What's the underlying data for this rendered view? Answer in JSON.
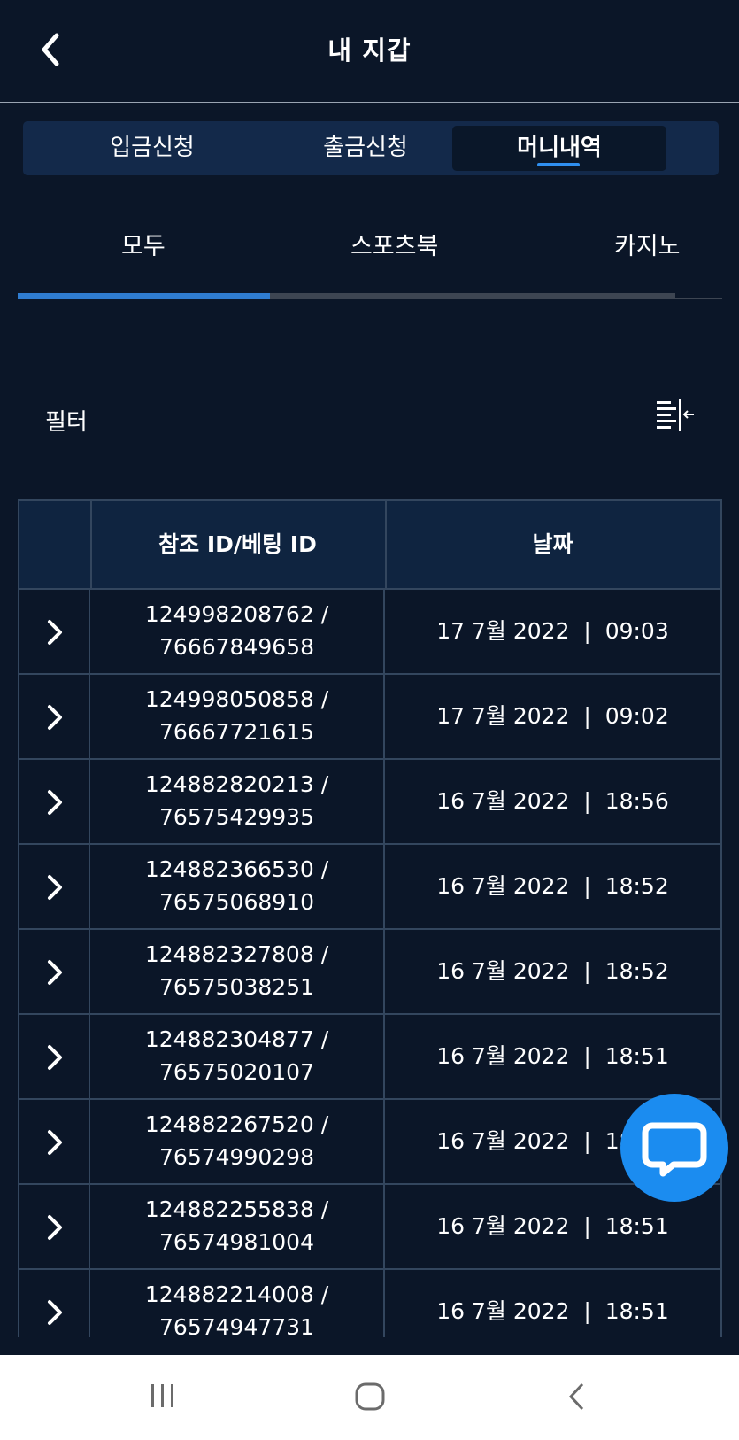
{
  "header": {
    "title": "내 지갑",
    "back_icon": "chevron-left-icon"
  },
  "wallet_tabs": [
    {
      "label": "입금신청",
      "active": false
    },
    {
      "label": "출금신청",
      "active": false
    },
    {
      "label": "머니내역",
      "active": true
    }
  ],
  "category_tabs": [
    {
      "label": "모두",
      "active": true
    },
    {
      "label": "스포츠북",
      "active": false
    },
    {
      "label": "카지노",
      "active": false
    }
  ],
  "filter": {
    "label": "필터",
    "icon": "filter-collapse-icon"
  },
  "table": {
    "headers": [
      "",
      "참조 ID/베팅 ID",
      "날짜"
    ],
    "rows": [
      {
        "ref": "124998208762 /",
        "bet": "76667849658",
        "date": "17 7월 2022  |  09:03"
      },
      {
        "ref": "124998050858 /",
        "bet": "76667721615",
        "date": "17 7월 2022  |  09:02"
      },
      {
        "ref": "124882820213 /",
        "bet": "76575429935",
        "date": "16 7월 2022  |  18:56"
      },
      {
        "ref": "124882366530 /",
        "bet": "76575068910",
        "date": "16 7월 2022  |  18:52"
      },
      {
        "ref": "124882327808 /",
        "bet": "76575038251",
        "date": "16 7월 2022  |  18:52"
      },
      {
        "ref": "124882304877 /",
        "bet": "76575020107",
        "date": "16 7월 2022  |  18:51"
      },
      {
        "ref": "124882267520 /",
        "bet": "76574990298",
        "date": "16 7월 2022  |  18:51"
      },
      {
        "ref": "124882255838 /",
        "bet": "76574981004",
        "date": "16 7월 2022  |  18:51"
      },
      {
        "ref": "124882214008 /",
        "bet": "76574947731",
        "date": "16 7월 2022  |  18:51"
      }
    ]
  },
  "chat_button": {
    "icon": "chat-bubble-icon",
    "color": "#1b8cf0"
  },
  "colors": {
    "background": "#0b1628",
    "accent": "#2f8ff0",
    "table_header": "#0f2440",
    "border": "#33465e"
  },
  "system_nav": {
    "recents_icon": "recents-icon",
    "home_icon": "home-icon",
    "back_icon": "back-icon"
  }
}
